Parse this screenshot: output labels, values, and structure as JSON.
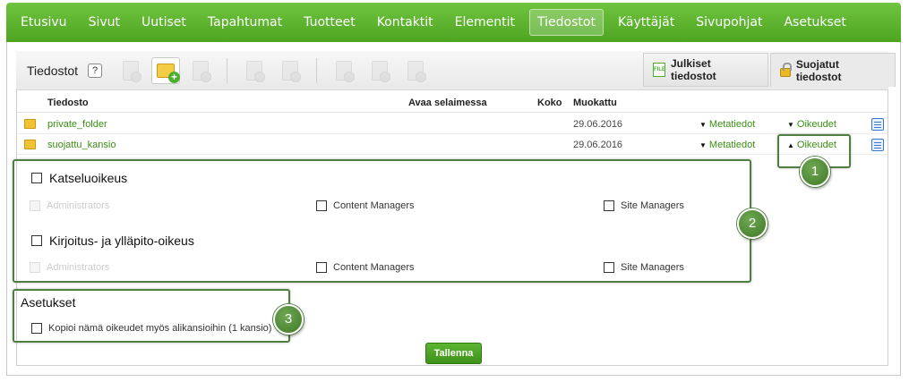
{
  "nav": {
    "items": [
      {
        "label": "Etusivu"
      },
      {
        "label": "Sivut"
      },
      {
        "label": "Uutiset"
      },
      {
        "label": "Tapahtumat"
      },
      {
        "label": "Tuotteet"
      },
      {
        "label": "Kontaktit"
      },
      {
        "label": "Elementit"
      },
      {
        "label": "Tiedostot",
        "active": true
      },
      {
        "label": "Käyttäjät"
      },
      {
        "label": "Sivupohjat"
      },
      {
        "label": "Asetukset"
      }
    ]
  },
  "toolbar": {
    "title": "Tiedostot",
    "help": "?",
    "tab_public": "Julkiset tiedostot",
    "tab_secure": "Suojatut tiedostot",
    "public_icon_text": "FILE"
  },
  "table": {
    "columns": [
      "Tiedosto",
      "Avaa selaimessa",
      "Koko",
      "Muokattu"
    ],
    "rows": [
      {
        "name": "private_folder",
        "modified": "29.06.2016",
        "meta": "Metatiedot",
        "rights": "Oikeudet"
      },
      {
        "name": "suojattu_kansio",
        "modified": "29.06.2016",
        "meta": "Metatiedot",
        "rights": "Oikeudet"
      }
    ]
  },
  "permissions": {
    "view": {
      "title": "Katseluoikeus",
      "options": [
        "Administrators",
        "Content Managers",
        "Site Managers"
      ]
    },
    "write": {
      "title": "Kirjoitus- ja ylläpito-oikeus",
      "options": [
        "Administrators",
        "Content Managers",
        "Site Managers"
      ]
    }
  },
  "settings": {
    "title": "Asetukset",
    "copy_label": "Kopioi nämä oikeudet myös alikansioihin (1 kansio)"
  },
  "save_label": "Tallenna",
  "callouts": [
    "1",
    "2",
    "3"
  ],
  "colors": {
    "nav_green": "#5bb52f",
    "link_green": "#3a8f12",
    "callout_green": "#4e7f3f"
  }
}
